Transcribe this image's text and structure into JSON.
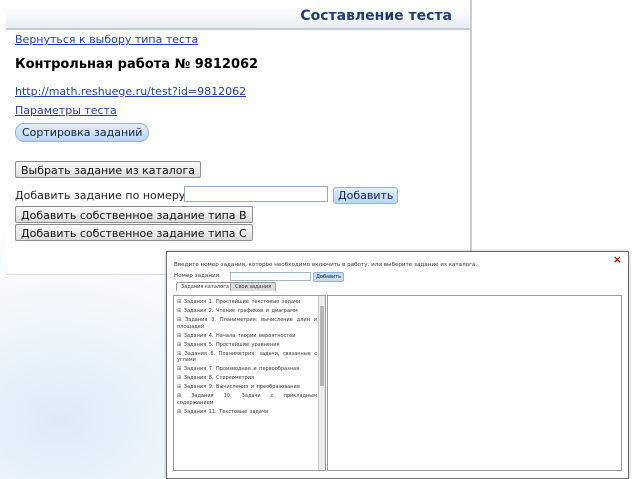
{
  "page": {
    "title": "Составление теста",
    "back_link": "Вернуться к выбору типа теста",
    "heading": "Контрольная работа № 9812062",
    "test_url": "http://math.reshuege.ru/test?id=9812062",
    "params_link": "Параметры теста",
    "sort_button": "Сортировка заданий",
    "catalog_button": "Выбрать задание из каталога",
    "add_by_number_label": "Добавить задание по номеру:",
    "add_by_number_value": "",
    "add_button": "Добавить",
    "add_own_b": "Добавить собственное задание типа B",
    "add_own_c": "Добавить собственное задание типа С"
  },
  "dialog": {
    "close_symbol": "×",
    "instruction": "Введите номер задания, которое необходимо включить в работу, или выберите задание из каталога.",
    "number_label": "Номер задания:",
    "number_value": "",
    "add_button": "Добавить",
    "tabs": [
      "Задания каталога",
      "Свои задания"
    ],
    "items": [
      "Задания 1. Простейшие текстовые задачи",
      "Задания 2. Чтение графиков и диаграмм",
      "Задания 3. Планиметрия: вычисление длин и площадей",
      "Задания 4. Начала теории вероятностей",
      "Задания 5. Простейшие уравнения",
      "Задания 6. Планиметрия: задачи, связанные с углами",
      "Задания 7. Производная и первообразная",
      "Задания 8. Стереометрия",
      "Задания 9. Вычисления и преобразования",
      "Задания 10. Задачи с прикладным содержанием",
      "Задания 11. Текстовые задачи"
    ]
  },
  "colors": {
    "title_text": "#1d3e73",
    "link": "#1f3fa6",
    "accent_button": "#bcd5f1",
    "close_icon": "#c00000"
  }
}
